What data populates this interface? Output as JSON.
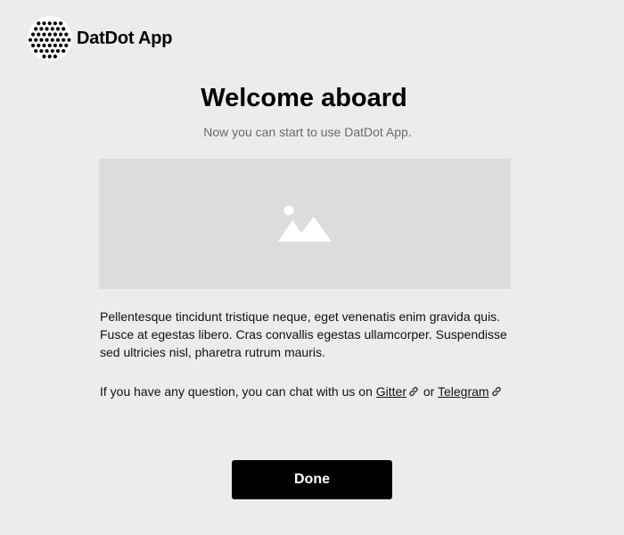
{
  "brand": {
    "name": "DatDot App",
    "logo_icon": "dotted-circle-logo-icon"
  },
  "main": {
    "title": "Welcome aboard",
    "subtitle": "Now you can start to use DatDot App.",
    "image_icon": "image-placeholder-icon",
    "paragraph": "Pellentesque tincidunt tristique neque, eget venenatis enim gravida quis. Fusce at egestas libero. Cras convallis egestas ullamcorper. Suspendisse sed ultricies nisl, pharetra rutrum mauris.",
    "contact": {
      "prefix": "If you have any question, you can chat with us on ",
      "link1": "Gitter",
      "separator": " or ",
      "link2": "Telegram",
      "link_icon": "external-link-icon"
    }
  },
  "footer": {
    "done_label": "Done"
  },
  "colors": {
    "background": "#ececec",
    "placeholder": "#dcdcdc",
    "button": "#000000",
    "button_text": "#ffffff",
    "muted_text": "#6a6a6a"
  }
}
